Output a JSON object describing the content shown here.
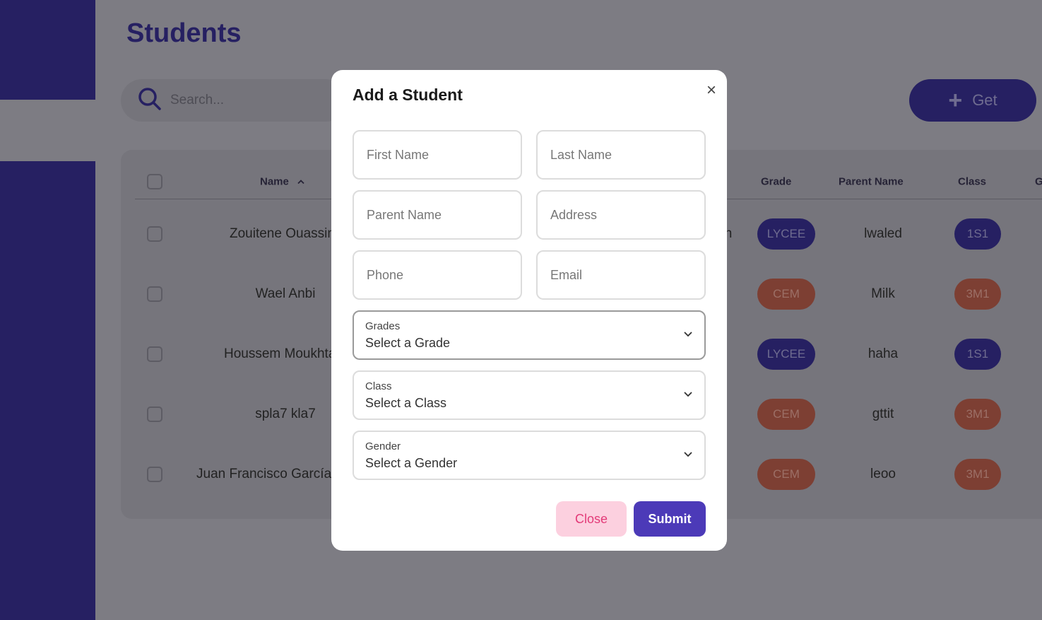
{
  "page": {
    "title": "Students"
  },
  "search": {
    "placeholder": "Search..."
  },
  "toolbar": {
    "get_label": "Get"
  },
  "table": {
    "headers": {
      "name": "Name",
      "grade": "Grade",
      "parent_name": "Parent Name",
      "class": "Class",
      "cut_off": "G"
    },
    "rows": [
      {
        "name": "Zouitene Ouassini",
        "hidden_tail": "n",
        "grade": "LYCEE",
        "parent": "lwaled",
        "class": "1S1"
      },
      {
        "name": "Wael Anbi",
        "grade": "CEM",
        "parent": "Milk",
        "class": "3M1"
      },
      {
        "name": "Houssem Moukhtar",
        "grade": "LYCEE",
        "parent": "haha",
        "class": "1S1"
      },
      {
        "name": "spla7 kla7",
        "grade": "CEM",
        "parent": "gttit",
        "class": "3M1"
      },
      {
        "name": "Juan Francisco García",
        "grade": "CEM",
        "parent": "leoo",
        "class": "3M1"
      }
    ]
  },
  "modal": {
    "title": "Add a Student",
    "close_icon": "×",
    "fields": {
      "first_name": "First Name",
      "last_name": "Last Name",
      "parent_name": "Parent Name",
      "address": "Address",
      "phone": "Phone",
      "email": "Email"
    },
    "selects": {
      "grades": {
        "label": "Grades",
        "value": "Select a Grade"
      },
      "class": {
        "label": "Class",
        "value": "Select a Class"
      },
      "gender": {
        "label": "Gender",
        "value": "Select a Gender"
      }
    },
    "buttons": {
      "close": "Close",
      "submit": "Submit"
    }
  },
  "colors": {
    "brand": "#262062",
    "accent": "#4c3ab8",
    "lycee": "#262062",
    "cem": "#c5573f",
    "close_bg": "#fcd0df",
    "close_text": "#e33a78"
  }
}
